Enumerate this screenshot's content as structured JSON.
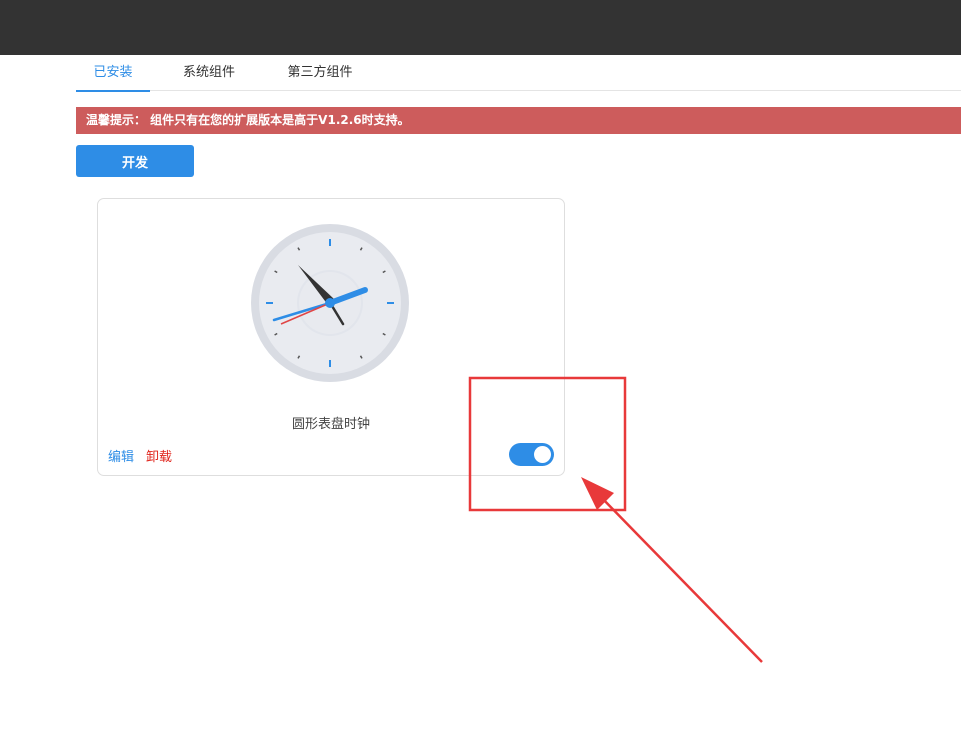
{
  "tabs": [
    {
      "label": "已安装",
      "active": true
    },
    {
      "label": "系统组件",
      "active": false
    },
    {
      "label": "第三方组件",
      "active": false
    }
  ],
  "notice": {
    "text": "温馨提示： 组件只有在您的扩展版本是高于V1.2.6时支持。"
  },
  "toolbar": {
    "dev_label": "开发"
  },
  "component": {
    "name": "圆形表盘时钟",
    "edit_label": "编辑",
    "uninstall_label": "卸载",
    "enabled": true,
    "icon": "clock-icon"
  },
  "colors": {
    "accent": "#2e8de6",
    "notice_bg": "#cd5c5c",
    "danger": "#e0241b",
    "topbar": "#333333",
    "annotation": "#e8393a"
  }
}
